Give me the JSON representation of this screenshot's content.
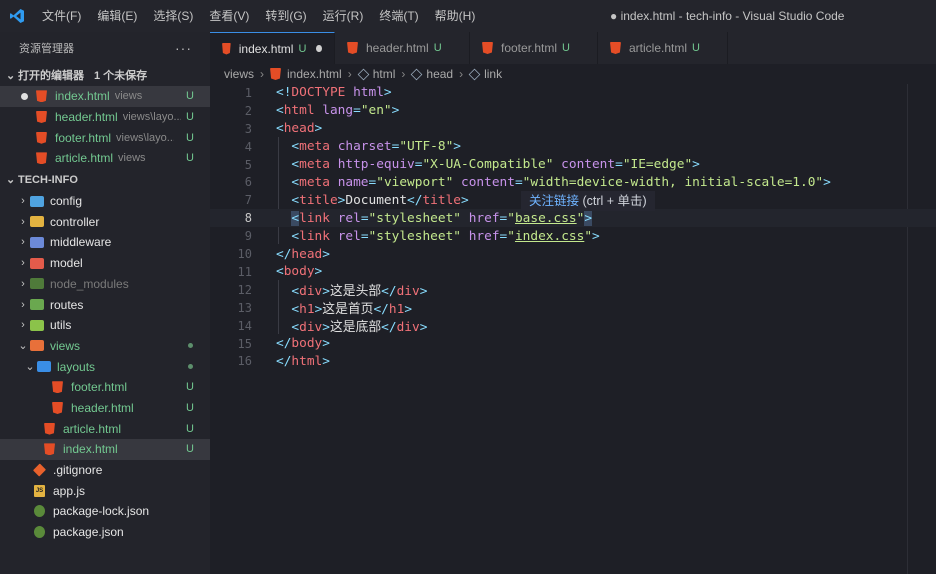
{
  "titlebar": {
    "menu": [
      "文件(F)",
      "编辑(E)",
      "选择(S)",
      "查看(V)",
      "转到(G)",
      "运行(R)",
      "终端(T)",
      "帮助(H)"
    ],
    "window_title": "● index.html - tech-info - Visual Studio Code"
  },
  "sidebar": {
    "title": "资源管理器",
    "more": "···",
    "open_editors": {
      "label": "打开的编辑器",
      "unsaved": "1 个未保存",
      "items": [
        {
          "name": "index.html",
          "desc": "views",
          "badge": "U"
        },
        {
          "name": "header.html",
          "desc": "views\\layo...",
          "badge": "U"
        },
        {
          "name": "footer.html",
          "desc": "views\\layo...",
          "badge": "U"
        },
        {
          "name": "article.html",
          "desc": "views",
          "badge": "U"
        }
      ]
    },
    "project": {
      "label": "TECH-INFO",
      "folders": [
        {
          "name": "config",
          "color": "#4fa3e0"
        },
        {
          "name": "controller",
          "color": "#e3b341"
        },
        {
          "name": "middleware",
          "color": "#6c8ad9"
        },
        {
          "name": "model",
          "color": "#e35b4b"
        },
        {
          "name": "node_modules",
          "color": "#6aa84f"
        },
        {
          "name": "routes",
          "color": "#6aa84f"
        },
        {
          "name": "utils",
          "color": "#8bc34a"
        }
      ],
      "views": {
        "name": "views",
        "color": "#e8703a"
      },
      "layouts": {
        "name": "layouts",
        "color": "#3a8ee6"
      },
      "layout_files": [
        {
          "name": "footer.html",
          "badge": "U"
        },
        {
          "name": "header.html",
          "badge": "U"
        }
      ],
      "view_files": [
        {
          "name": "article.html",
          "badge": "U"
        },
        {
          "name": "index.html",
          "badge": "U"
        }
      ],
      "root_files": [
        {
          "name": ".gitignore"
        },
        {
          "name": "app.js",
          "icon_text": "JS"
        },
        {
          "name": "package-lock.json"
        },
        {
          "name": "package.json"
        }
      ]
    }
  },
  "tabs": [
    {
      "label": "index.html",
      "u": "U"
    },
    {
      "label": "header.html",
      "u": "U"
    },
    {
      "label": "footer.html",
      "u": "U"
    },
    {
      "label": "article.html",
      "u": "U"
    }
  ],
  "breadcrumb": [
    "views",
    "index.html",
    "html",
    "head",
    "link"
  ],
  "tooltip": {
    "main": "关注链接",
    "hint": " (ctrl + 单击)"
  },
  "editor": {
    "line_numbers": [
      "1",
      "2",
      "3",
      "4",
      "5",
      "6",
      "7",
      "8",
      "9",
      "10",
      "11",
      "12",
      "13",
      "14",
      "15",
      "16"
    ],
    "current_line": 8
  }
}
